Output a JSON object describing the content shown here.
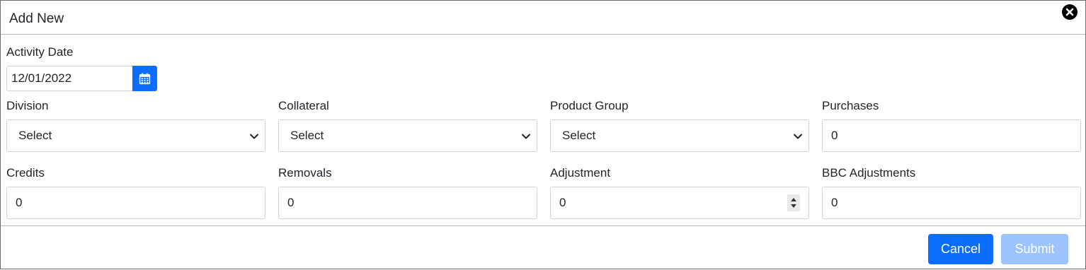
{
  "dialog": {
    "title": "Add New"
  },
  "icons": {
    "close": "close-circle-icon",
    "calendar": "calendar-icon",
    "chevron": "chevron-down-icon",
    "spinner": "number-spinner-icon"
  },
  "colors": {
    "primary": "#0d6efd",
    "primary_disabled": "#9cc3fb",
    "border": "#ced4da"
  },
  "activity_date": {
    "label": "Activity Date",
    "value": "12/01/2022"
  },
  "fields": {
    "division": {
      "label": "Division",
      "value": "Select"
    },
    "collateral": {
      "label": "Collateral",
      "value": "Select"
    },
    "product_group": {
      "label": "Product Group",
      "value": "Select"
    },
    "purchases": {
      "label": "Purchases",
      "value": "0"
    },
    "credits": {
      "label": "Credits",
      "value": "0"
    },
    "removals": {
      "label": "Removals",
      "value": "0"
    },
    "adjustment": {
      "label": "Adjustment",
      "value": "0"
    },
    "bbc_adjustments": {
      "label": "BBC Adjustments",
      "value": "0"
    }
  },
  "footer": {
    "cancel_label": "Cancel",
    "submit_label": "Submit"
  }
}
